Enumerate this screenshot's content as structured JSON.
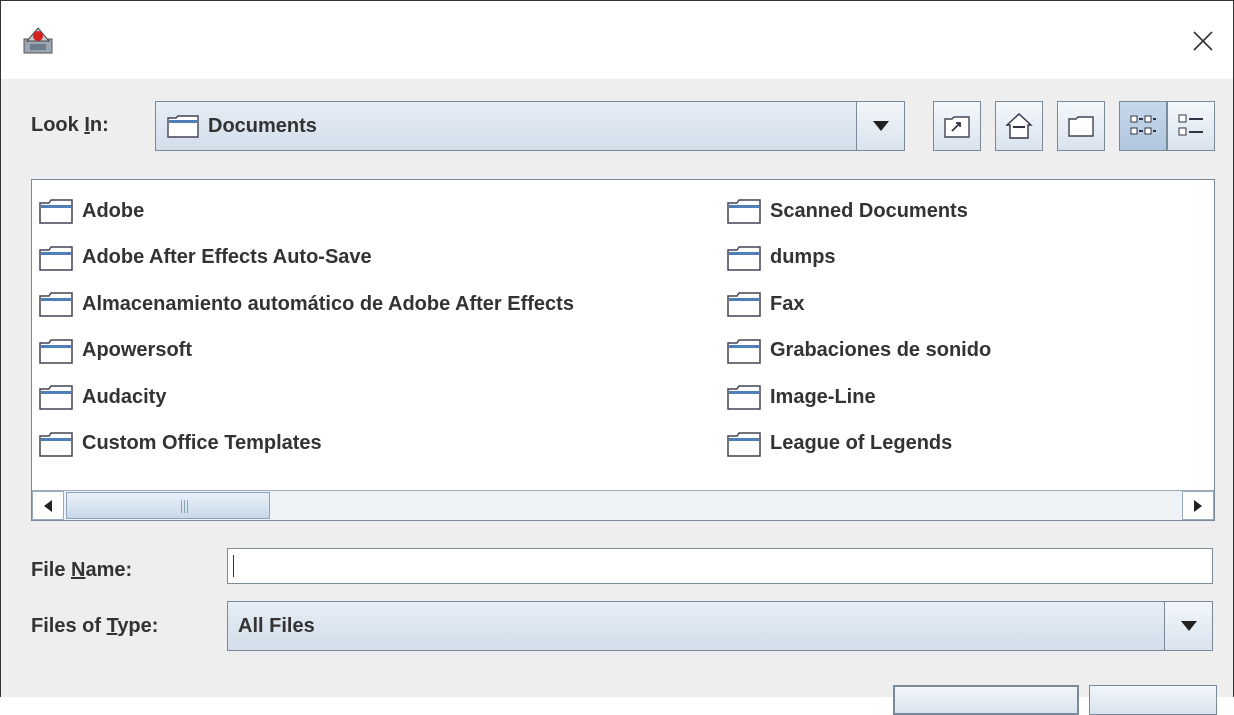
{
  "dialog": {
    "close_glyph": "✕"
  },
  "toolbar": {
    "look_in_label_pre": "Look ",
    "look_in_label_u": "I",
    "look_in_label_post": "n:",
    "look_in_value": "Documents",
    "buttons": [
      "up-one-level",
      "home",
      "create-new-folder",
      "list-view",
      "details-view"
    ]
  },
  "files": {
    "left": [
      "Adobe",
      "Adobe After Effects Auto-Save",
      "Almacenamiento automático de Adobe After Effects",
      "Apowersoft",
      "Audacity",
      "Custom Office Templates"
    ],
    "right": [
      "Scanned Documents",
      "dumps",
      "Fax",
      "Grabaciones de sonido",
      "Image-Line",
      "League of Legends"
    ]
  },
  "file_name": {
    "label_pre": "File ",
    "label_u": "N",
    "label_post": "ame:",
    "value": ""
  },
  "file_type": {
    "label_pre": "Files of ",
    "label_u": "T",
    "label_post": "ype:",
    "value": "All Files"
  },
  "colors": {
    "border": "#7a8a99",
    "button_gradient_top": "#f2f6fa",
    "button_gradient_bottom": "#d9e3ee",
    "background": "#eeeeee"
  }
}
